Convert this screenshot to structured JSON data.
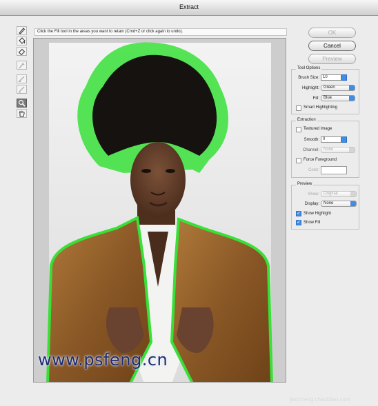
{
  "window": {
    "title": "Extract"
  },
  "instruction": "Click the Fill tool in the areas you want to retain (Cmd+Z or click again to undo).",
  "tools": [
    {
      "name": "edge-highlighter-icon",
      "active": false,
      "dim": false
    },
    {
      "name": "fill-bucket-icon",
      "active": false,
      "dim": false
    },
    {
      "name": "eraser-icon",
      "active": false,
      "dim": false
    },
    {
      "name": "eyedropper-icon",
      "active": false,
      "dim": true
    },
    {
      "name": "cleanup-tool-icon",
      "active": false,
      "dim": true
    },
    {
      "name": "edge-touchup-icon",
      "active": false,
      "dim": true
    },
    {
      "name": "zoom-icon",
      "active": true,
      "dim": false
    },
    {
      "name": "hand-icon",
      "active": false,
      "dim": false
    }
  ],
  "buttons": {
    "ok": "OK",
    "cancel": "Cancel",
    "preview": "Preview"
  },
  "tool_options": {
    "caption": "Tool Options",
    "brush_size_label": "Brush Size:",
    "brush_size_value": "10",
    "highlight_label": "Highlight:",
    "highlight_value": "Green",
    "fill_label": "Fill:",
    "fill_value": "Blue",
    "smart_highlighting": "Smart Highlighting"
  },
  "extraction": {
    "caption": "Extraction",
    "textured_image": "Textured Image",
    "smooth_label": "Smooth:",
    "smooth_value": "0",
    "channel_label": "Channel:",
    "channel_value": "None",
    "force_foreground": "Force Foreground",
    "color_label": "Color:"
  },
  "preview": {
    "caption": "Preview",
    "show_label": "Show:",
    "show_value": "Original",
    "display_label": "Display:",
    "display_value": "None",
    "show_highlight": "Show Highlight",
    "show_highlight_checked": true,
    "show_fill": "Show Fill",
    "show_fill_checked": true
  },
  "watermark": "www.psfeng.cn",
  "watermark_corner": "jiaocheng.chazidian.com",
  "colors": {
    "highlight": "#38e038",
    "accent": "#3f8de6"
  }
}
